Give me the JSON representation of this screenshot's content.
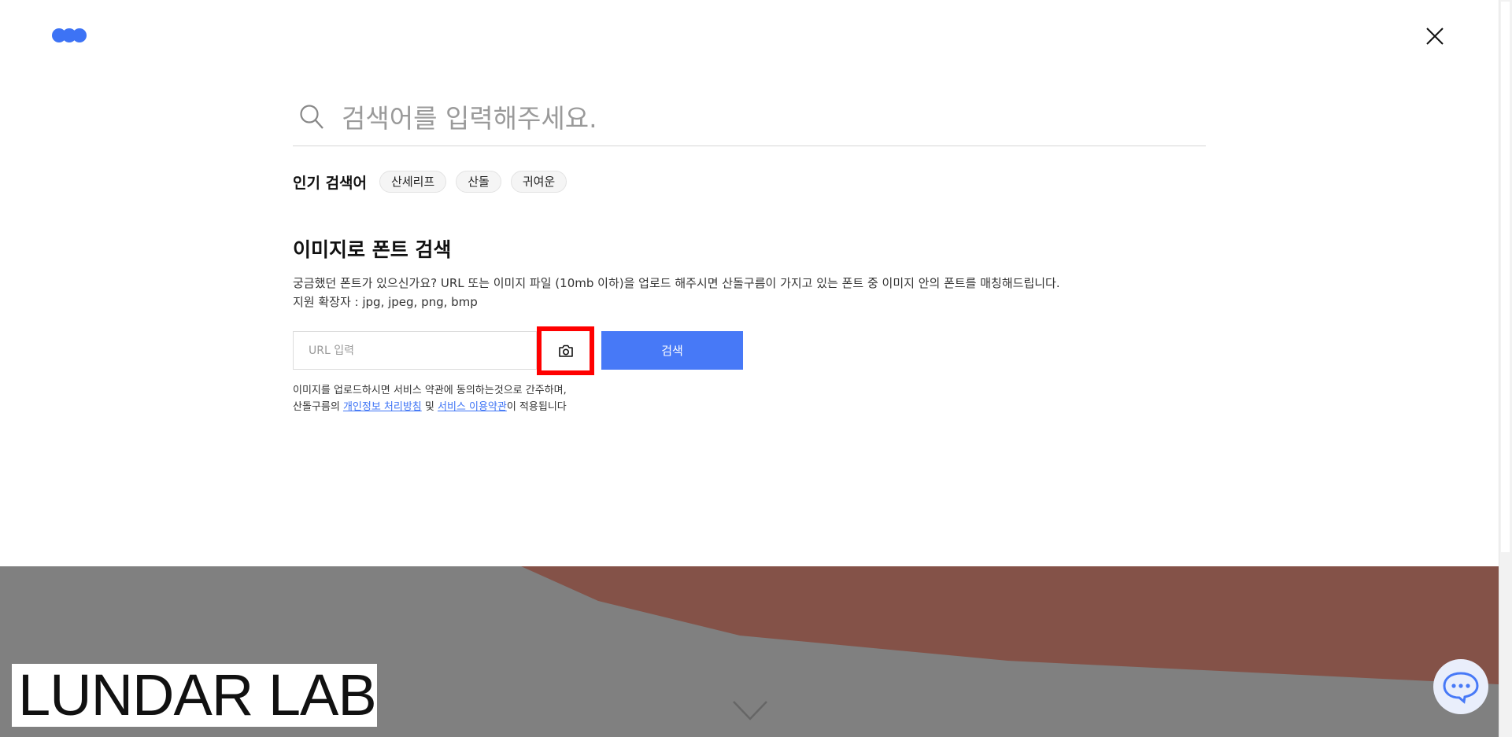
{
  "header": {
    "logo_name": "sandoll-logo",
    "close_icon": "close-icon"
  },
  "search": {
    "placeholder": "검색어를 입력해주세요."
  },
  "popular": {
    "title": "인기 검색어",
    "keywords": [
      "산세리프",
      "산돌",
      "귀여운"
    ]
  },
  "image_search": {
    "title": "이미지로 폰트 검색",
    "description_line1": "궁금했던 폰트가 있으신가요? URL 또는 이미지 파일 (10mb 이하)을 업로드 해주시면 산돌구름이 가지고 있는 폰트 중 이미지 안의 폰트를 매칭해드립니다.",
    "description_line2": "지원 확장자 : jpg, jpeg, png, bmp",
    "url_placeholder": "URL 입력",
    "camera_icon": "camera-icon",
    "search_button": "검색",
    "agree_line1": "이미지를 업로드하시면 서비스 약관에 동의하는것으로 간주하며,",
    "agree_prefix": "산돌구름의 ",
    "privacy_link": "개인정보 처리방침",
    "and_text": " 및 ",
    "terms_link": "서비스 이용약관",
    "agree_suffix": "이 적용됩니다"
  },
  "background": {
    "watermark": "LUNDAR LAB",
    "scroll_icon": "chevron-down-icon",
    "chat_icon": "chat-icon"
  },
  "colors": {
    "accent": "#4779f7",
    "highlight": "#ff0000",
    "hero_gray": "#808080",
    "hero_red": "#845248"
  }
}
